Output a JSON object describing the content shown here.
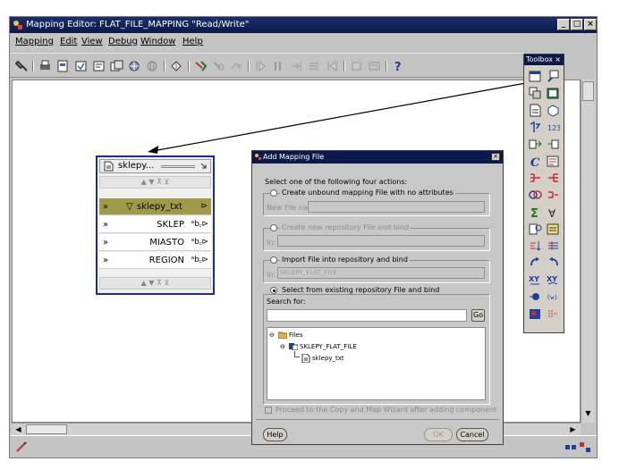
{
  "window": {
    "title": "Mapping Editor: FLAT_FILE_MAPPING \"Read/Write\"",
    "minimize": "_",
    "maximize": "□",
    "close": "×"
  },
  "menu": [
    "Mapping",
    "Edit",
    "View",
    "Debug",
    "Window",
    "Help"
  ],
  "toolbox": {
    "title": "Toolbox",
    "close": "×",
    "function_symbol": "C",
    "sum_symbol": "Σ",
    "filter_symbol": "∀",
    "xy_symbol": "XY"
  },
  "operator": {
    "title": "sklepy...",
    "group": "sklepy_txt",
    "chevron": "»",
    "type_glyph": "ᵃb꜀",
    "nav_arrows": "▲ ▼ ⊼ ⊻",
    "attributes": [
      {
        "name": "SKLEP"
      },
      {
        "name": "MIASTO"
      },
      {
        "name": "REGION"
      }
    ]
  },
  "dialog": {
    "title": "Add Mapping File",
    "close": "×",
    "instruction": "Select one of the following four actions:",
    "option1": "Create unbound mapping File with no attributes",
    "new_file_name_label": "New File name:",
    "option2": "Create new repository File and bind",
    "in_label": "In:",
    "option3": "Import File into repository and bind",
    "option3_in_value": "SKLEPY_FLAT_FILE",
    "option4": "Select from existing repository File and bind",
    "search_label": "Search for:",
    "go_button": "Go",
    "tree": {
      "root": "Files",
      "file": "SKLEPY_FLAT_FILE",
      "record": "sklepy_txt"
    },
    "proceed_checkbox": "Proceed to the Copy and Map Wizard after adding component",
    "help_button": "Help",
    "ok_button": "OK",
    "cancel_button": "Cancel"
  },
  "colors": {
    "title_bar": "#0a1a4a",
    "group_row": "#9e9a48",
    "operator_border": "#1b2f8a"
  }
}
